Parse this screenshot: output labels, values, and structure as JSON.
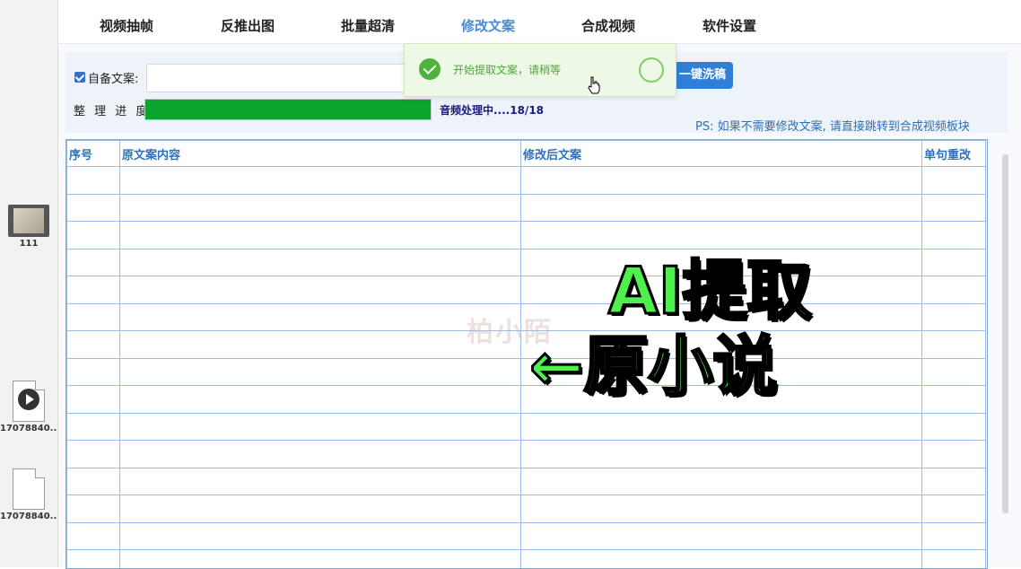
{
  "desktop": {
    "items": [
      {
        "label": "111",
        "icon": "video-file-icon"
      },
      {
        "label": "17078840...",
        "icon": "media-file-icon"
      },
      {
        "label": "17078840...",
        "icon": "document-file-icon"
      }
    ]
  },
  "tabs": [
    {
      "label": "视频抽帧"
    },
    {
      "label": "反推出图"
    },
    {
      "label": "批量超清"
    },
    {
      "label": "修改文案"
    },
    {
      "label": "合成视频"
    },
    {
      "label": "软件设置"
    }
  ],
  "active_tab": "修改文案",
  "form": {
    "checkbox_label": "自备文案:",
    "checkbox_checked": true,
    "copy_input_value": "",
    "wash_button_label": "一键洗稿",
    "progress_label": "整 理 进 度:",
    "progress_value": 1.0,
    "progress_status": "音频处理中....18/18",
    "ps_note": "PS: 如果不需要修改文案, 请直接跳转到合成视频板块"
  },
  "toast": {
    "message": "开始提取文案，请稍等",
    "icon": "success-check-icon"
  },
  "table": {
    "columns": [
      "序号",
      "原文案内容",
      "修改后文案",
      "单句重改"
    ],
    "rows": [
      [
        "",
        "",
        "",
        ""
      ],
      [
        "",
        "",
        "",
        ""
      ],
      [
        "",
        "",
        "",
        ""
      ],
      [
        "",
        "",
        "",
        ""
      ],
      [
        "",
        "",
        "",
        ""
      ],
      [
        "",
        "",
        "",
        ""
      ],
      [
        "",
        "",
        "",
        ""
      ],
      [
        "",
        "",
        "",
        ""
      ],
      [
        "",
        "",
        "",
        ""
      ],
      [
        "",
        "",
        "",
        ""
      ],
      [
        "",
        "",
        "",
        ""
      ],
      [
        "",
        "",
        "",
        ""
      ],
      [
        "",
        "",
        "",
        ""
      ],
      [
        "",
        "",
        "",
        ""
      ],
      [
        "",
        "",
        "",
        ""
      ]
    ]
  },
  "watermark": "柏小陌",
  "overlay": {
    "line1": "AI提取",
    "line2": "←原小说"
  },
  "colors": {
    "accent": "#2f7fd7",
    "active_tab": "#4a8bd4",
    "progress": "#0aa52c",
    "toast_bg": "#eef8e6",
    "overlay_text": "#4df04d"
  }
}
